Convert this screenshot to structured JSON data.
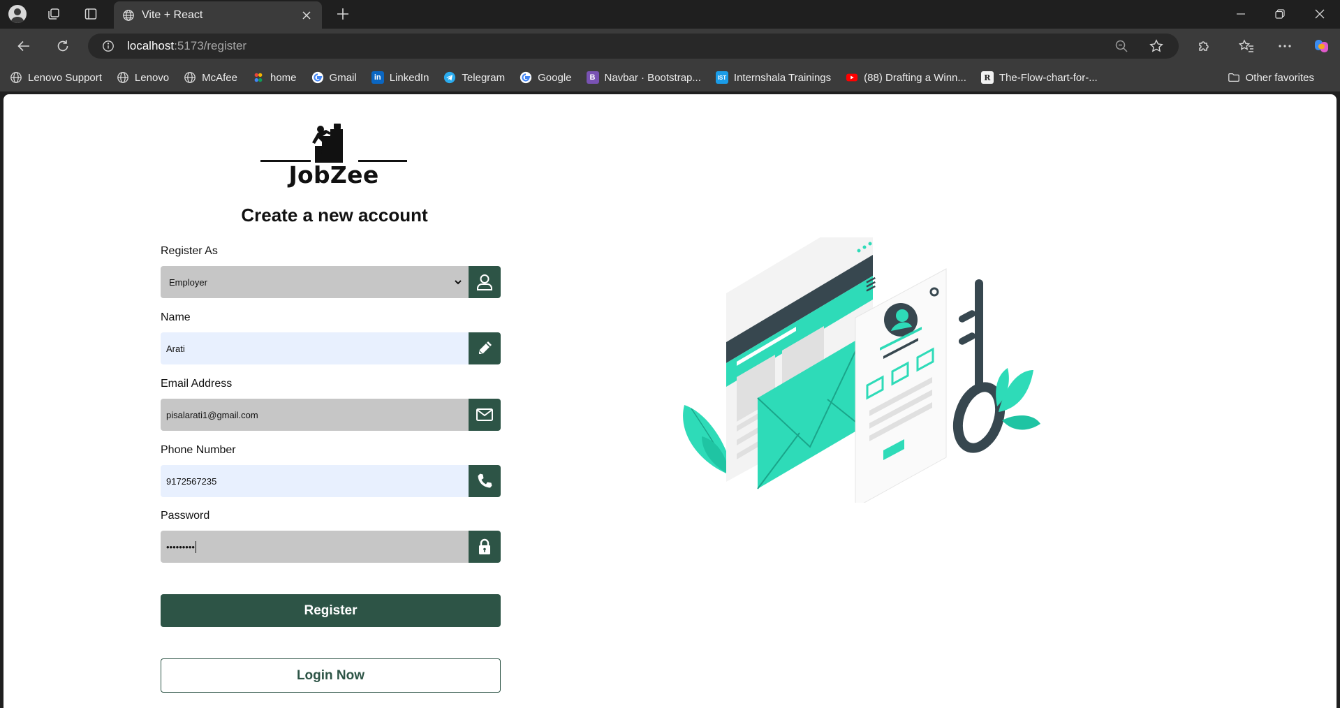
{
  "browser": {
    "tab": {
      "title": "Vite + React"
    },
    "address": {
      "host": "localhost",
      "rest": ":5173/register"
    },
    "bookmarks": [
      {
        "label": "Lenovo Support",
        "icon": "globe-icon"
      },
      {
        "label": "Lenovo",
        "icon": "globe-icon"
      },
      {
        "label": "McAfee",
        "icon": "globe-icon"
      },
      {
        "label": "home",
        "icon": "s-logo-icon"
      },
      {
        "label": "Gmail",
        "icon": "google-icon"
      },
      {
        "label": "LinkedIn",
        "icon": "linkedin-icon"
      },
      {
        "label": "Telegram",
        "icon": "telegram-icon"
      },
      {
        "label": "Google",
        "icon": "google-icon"
      },
      {
        "label": "Navbar · Bootstrap...",
        "icon": "bootstrap-icon"
      },
      {
        "label": "Internshala Trainings",
        "icon": "internshala-icon"
      },
      {
        "label": "(88) Drafting a Winn...",
        "icon": "youtube-icon"
      },
      {
        "label": "The-Flow-chart-for-...",
        "icon": "r-icon"
      }
    ],
    "other_favorites": "Other favorites"
  },
  "page": {
    "brand": "JobZee",
    "heading": "Create a new account",
    "form": {
      "role": {
        "label": "Register As",
        "value": "Employer"
      },
      "name": {
        "label": "Name",
        "value": "Arati"
      },
      "email": {
        "label": "Email Address",
        "value": "pisalarati1@gmail.com"
      },
      "phone": {
        "label": "Phone Number",
        "value": "9172567235"
      },
      "password": {
        "label": "Password",
        "value": "•••••••••"
      }
    },
    "register_button": "Register",
    "login_button": "Login Now"
  },
  "colors": {
    "primary": "#2d5446",
    "accent": "#2edbb8",
    "illustration_dark": "#37474f"
  }
}
